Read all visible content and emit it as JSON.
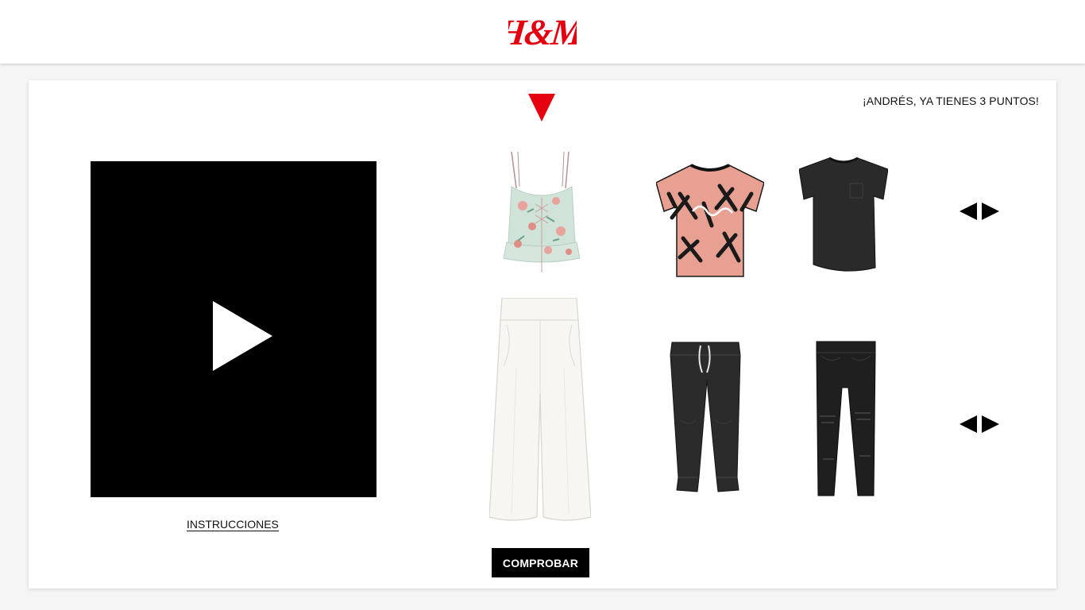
{
  "header": {
    "logo_text": "H&M",
    "logo_color": "#e50010"
  },
  "game": {
    "points_message": "¡ANDRÉS, YA TIENES 3 PUNTOS!",
    "selector_color": "#e50010",
    "instructions_label": "INSTRUCCIONES",
    "check_button_label": "COMPROBAR",
    "top_row": [
      {
        "name": "floral-camisole-top",
        "icon": "floral-top-image"
      },
      {
        "name": "palm-print-tshirt",
        "icon": "palm-tshirt-image"
      },
      {
        "name": "black-pocket-tshirt",
        "icon": "black-tshirt-image"
      }
    ],
    "bottom_row": [
      {
        "name": "white-wide-trousers",
        "icon": "white-trousers-image"
      },
      {
        "name": "black-jogger-pants",
        "icon": "black-joggers-image"
      },
      {
        "name": "black-ripped-jeans",
        "icon": "black-jeans-image"
      }
    ]
  }
}
